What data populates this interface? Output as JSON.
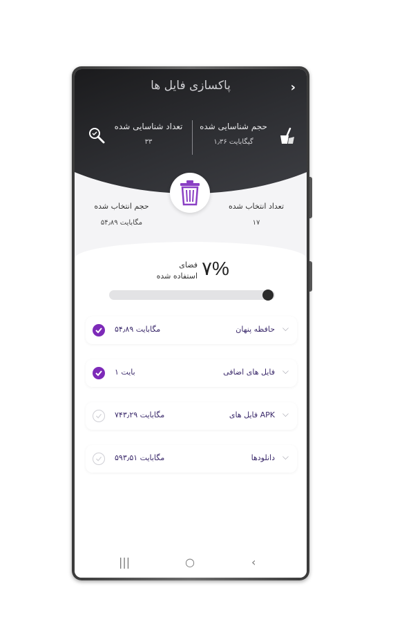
{
  "header": {
    "title": "پاکسازی فایل ها",
    "back_icon": "chevron-right-icon"
  },
  "stats": {
    "identified_size": {
      "label": "حجم شناسایی شده",
      "value": "۱٫۳۶ گیگابایت"
    },
    "identified_count": {
      "label": "تعداد شناسایی شده",
      "value": "۳۳"
    }
  },
  "selection": {
    "selected_count": {
      "label": "تعداد انتخاب شده",
      "value": "۱۷"
    },
    "selected_size": {
      "label": "حجم انتخاب شده",
      "value": "۵۴٫۸۹ مگابایت"
    }
  },
  "usage": {
    "percent": "۷%",
    "label_line1": "فضای",
    "label_line2": "استفاده شده",
    "progress_fraction": 0.07
  },
  "items": [
    {
      "name": "حافظه پنهان",
      "size": "۵۴٫۸۹ مگابایت",
      "checked": true
    },
    {
      "name": "فایل های اضافی",
      "size": "۱ بایت",
      "checked": true
    },
    {
      "name": "فایل های APK",
      "size": "۷۴۳٫۲۹ مگابایت",
      "checked": false
    },
    {
      "name": "دانلودها",
      "size": "۵۹۳٫۵۱ مگابایت",
      "checked": false
    }
  ],
  "colors": {
    "accent": "#7d2ab8",
    "header_dark": "#1b1b1d",
    "text_dark": "#3b2a6b"
  },
  "nav": {
    "recent": "|||",
    "home": "○",
    "back": "‹"
  }
}
